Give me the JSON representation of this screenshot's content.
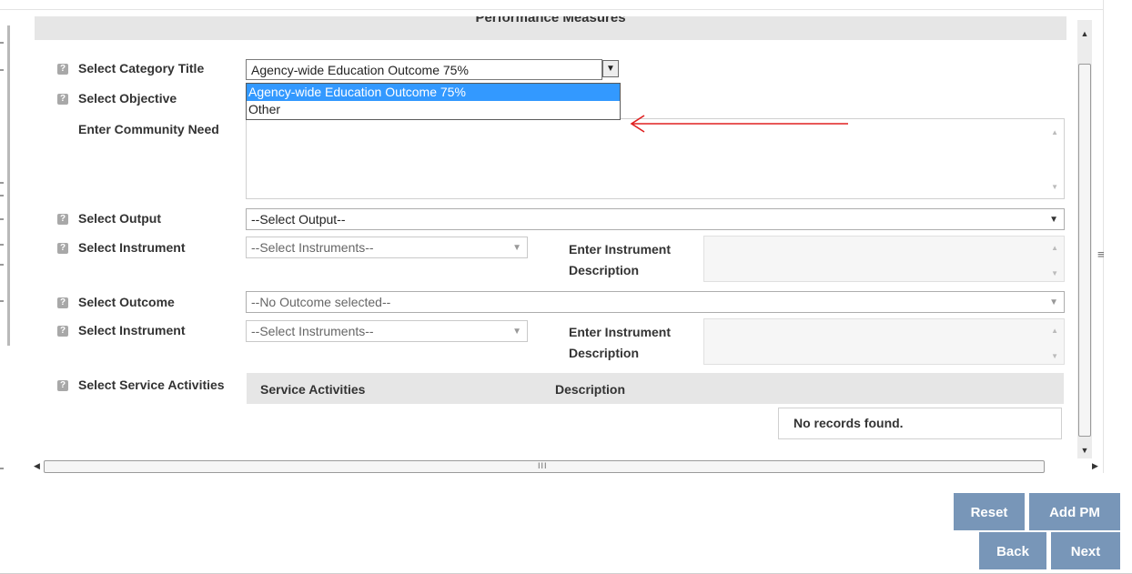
{
  "section": {
    "title": "Performance Measures"
  },
  "fields": {
    "category_title": {
      "label": "Select Category Title",
      "value": "Agency-wide Education Outcome 75%",
      "options": [
        "Agency-wide Education Outcome 75%",
        "Other"
      ]
    },
    "objective": {
      "label": "Select Objective"
    },
    "community_need": {
      "label": "Enter Community Need",
      "value": ""
    },
    "output": {
      "label": "Select Output",
      "value": "--Select Output--"
    },
    "instrument_1": {
      "label": "Select Instrument",
      "value": "--Select Instruments--",
      "desc_label_line1": "Enter Instrument",
      "desc_label_line2": "Description"
    },
    "outcome": {
      "label": "Select Outcome",
      "value": "--No Outcome selected--"
    },
    "instrument_2": {
      "label": "Select Instrument",
      "value": "--Select Instruments--",
      "desc_label_line1": "Enter Instrument",
      "desc_label_line2": "Description"
    },
    "service_activities": {
      "label": "Select Service Activities"
    }
  },
  "grid": {
    "columns": [
      "Service Activities",
      "Description"
    ],
    "empty_message": "No records found."
  },
  "icons": {
    "help": "?",
    "scroll_grip": "≡",
    "hscroll_grip": "III"
  },
  "buttons": {
    "reset": "Reset",
    "add_pm": "Add PM",
    "back": "Back",
    "next": "Next"
  },
  "colors": {
    "accent_button": "#7896b8",
    "dropdown_highlight": "#3399ff",
    "annotation_arrow": "#e02020"
  }
}
